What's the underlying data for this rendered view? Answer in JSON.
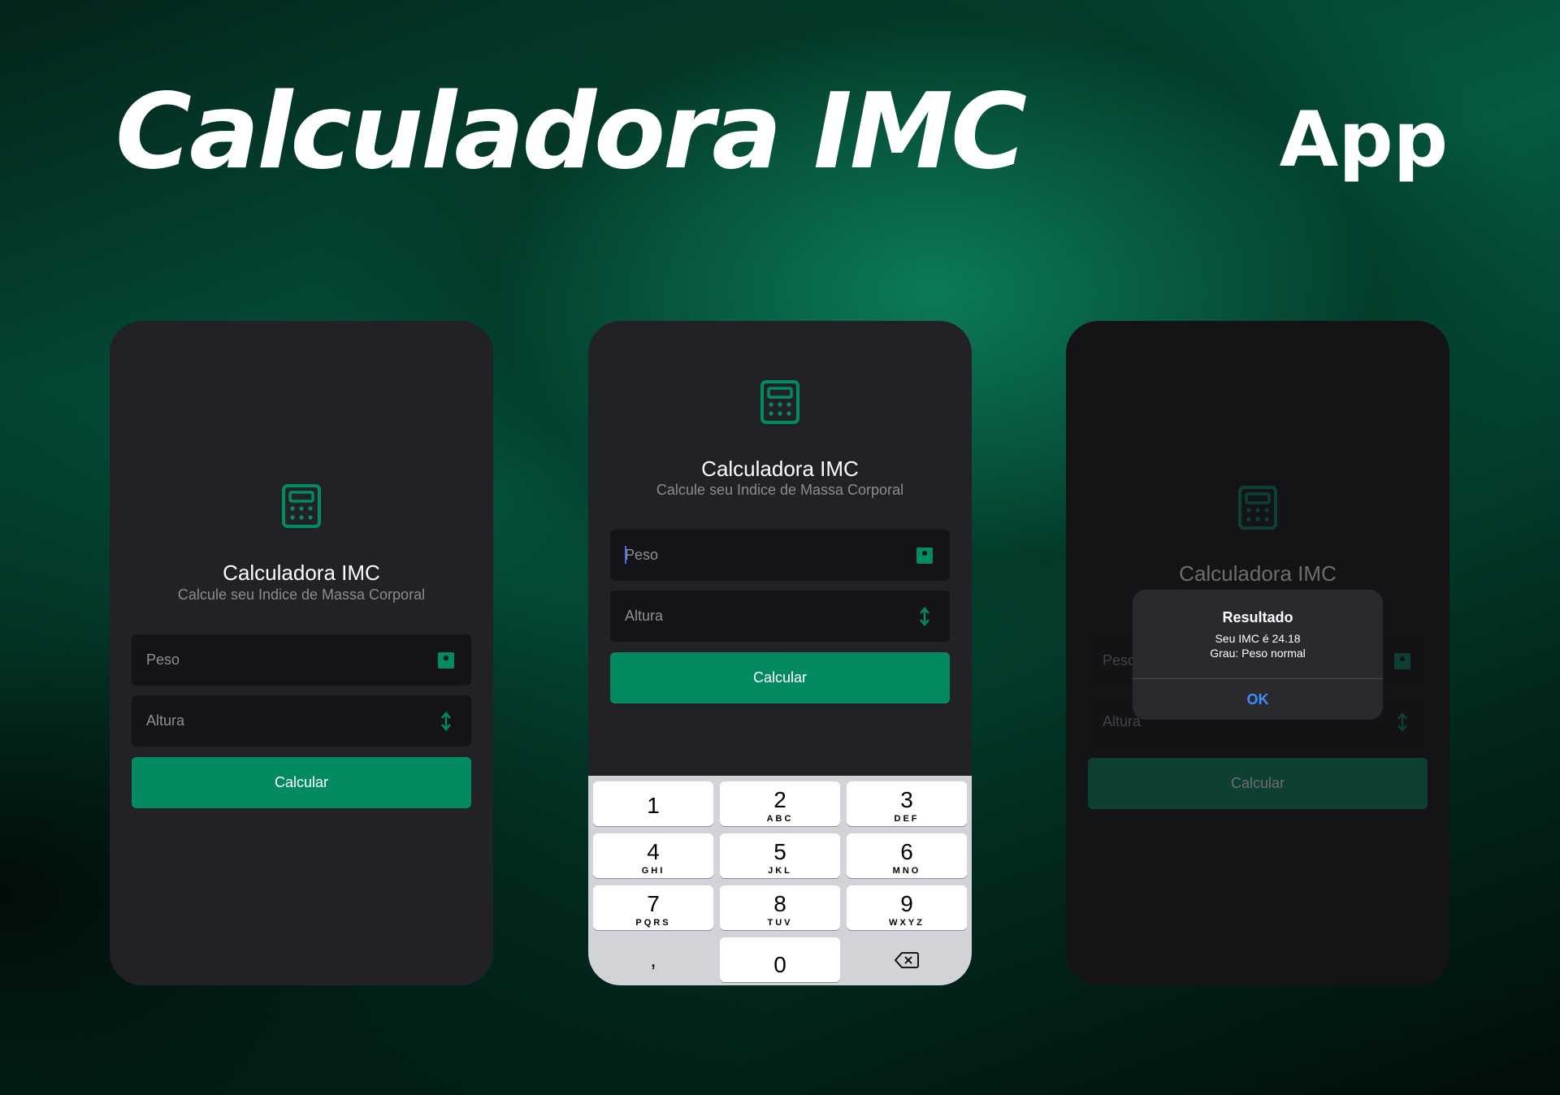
{
  "hero": {
    "title": "Calculadora IMC",
    "tag": "App"
  },
  "colors": {
    "accent": "#048a62",
    "screen_bg": "#212126",
    "field_bg": "#141418",
    "link_blue": "#3d8fff"
  },
  "screens": [
    {
      "title": "Calculadora IMC",
      "subtitle": "Calcule seu Indice de Massa Corporal",
      "logo_icon": "calculator-icon",
      "fields": [
        {
          "placeholder": "Peso",
          "icon": "scale-icon"
        },
        {
          "placeholder": "Altura",
          "icon": "height-arrows-icon"
        }
      ],
      "button": "Calcular"
    },
    {
      "title": "Calculadora IMC",
      "subtitle": "Calcule seu Indice de Massa Corporal",
      "logo_icon": "calculator-icon",
      "fields": [
        {
          "placeholder": "Peso",
          "icon": "scale-icon",
          "focused": true
        },
        {
          "placeholder": "Altura",
          "icon": "height-arrows-icon"
        }
      ],
      "button": "Calcular",
      "keyboard": {
        "keys": [
          {
            "num": "1",
            "letters": ""
          },
          {
            "num": "2",
            "letters": "ABC"
          },
          {
            "num": "3",
            "letters": "DEF"
          },
          {
            "num": "4",
            "letters": "GHI"
          },
          {
            "num": "5",
            "letters": "JKL"
          },
          {
            "num": "6",
            "letters": "MNO"
          },
          {
            "num": "7",
            "letters": "PQRS"
          },
          {
            "num": "8",
            "letters": "TUV"
          },
          {
            "num": "9",
            "letters": "WXYZ"
          }
        ],
        "comma": ",",
        "zero": "0",
        "backspace_icon": "backspace-icon"
      }
    },
    {
      "title": "Calculadora IMC",
      "logo_icon": "calculator-icon",
      "fields": [
        {
          "placeholder": "Peso",
          "icon": "scale-icon"
        },
        {
          "placeholder": "Altura",
          "icon": "height-arrows-icon"
        }
      ],
      "button": "Calcular",
      "alert": {
        "title": "Resultado",
        "line1": "Seu IMC é 24.18",
        "line2": "Grau: Peso normal",
        "ok": "OK"
      }
    }
  ]
}
